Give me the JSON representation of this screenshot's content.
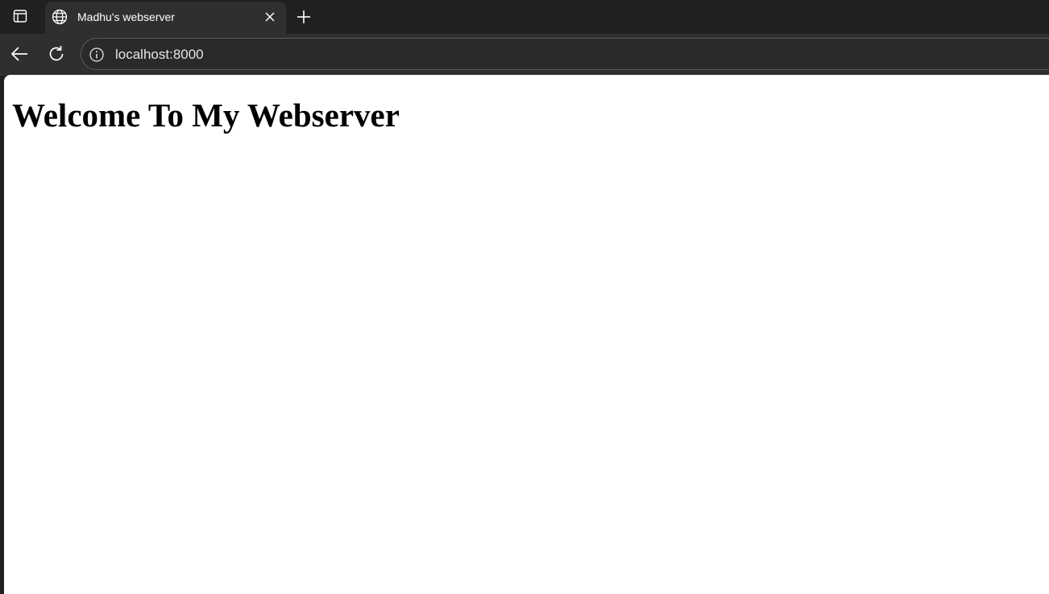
{
  "tab": {
    "title": "Madhu's webserver",
    "favicon": "globe-icon"
  },
  "tabstrip": {
    "actions_icon": "tab-actions-icon",
    "close_icon": "close-icon",
    "new_tab_icon": "plus-icon"
  },
  "toolbar": {
    "back_icon": "arrow-left-icon",
    "reload_icon": "reload-icon",
    "site_info_icon": "info-icon",
    "url": "localhost:8000"
  },
  "page": {
    "heading": "Welcome To My Webserver"
  },
  "colors": {
    "frame": "#202020",
    "toolbar": "#2f2f2f",
    "page_background": "#ffffff",
    "text_light": "#ffffff"
  }
}
